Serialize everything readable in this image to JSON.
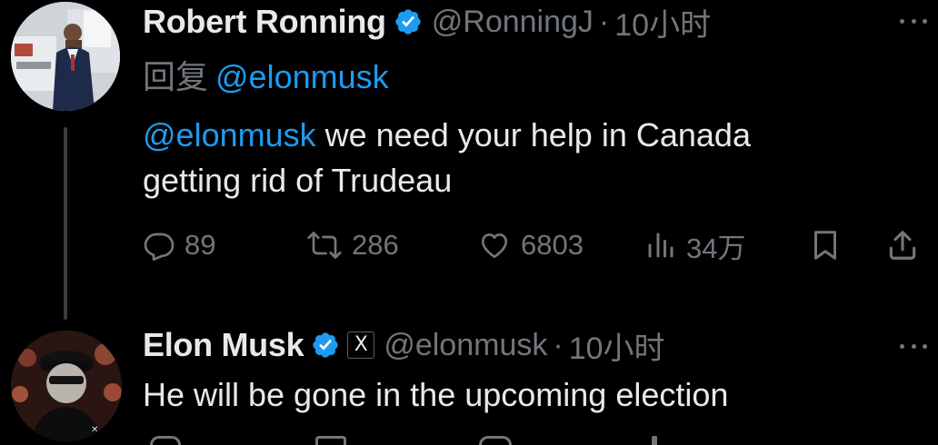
{
  "tweets": [
    {
      "author": {
        "display_name": "Robert Ronning",
        "handle": "@RonningJ",
        "verified": true,
        "avatar_icon": "profile-photo"
      },
      "separator": "·",
      "time": "10小时",
      "reply_to": {
        "prefix": "回复",
        "mention": "@elonmusk"
      },
      "text": {
        "mention": "@elonmusk",
        "line1_rest": " we need your help in Canada",
        "line2": "getting rid of Trudeau"
      },
      "stats": {
        "replies": "89",
        "retweets": "286",
        "likes": "6803",
        "views": "34万"
      }
    },
    {
      "author": {
        "display_name": "Elon Musk",
        "handle": "@elonmusk",
        "verified": true,
        "affiliate_badge": "X",
        "avatar_icon": "profile-photo"
      },
      "separator": "·",
      "time": "10小时",
      "text": {
        "line1": "He will be gone in the upcoming election"
      }
    }
  ],
  "colors": {
    "background": "#000000",
    "text": "#e7e9ea",
    "muted": "#71767b",
    "accent": "#1d9bf0",
    "thread_line": "#3a3d41"
  }
}
